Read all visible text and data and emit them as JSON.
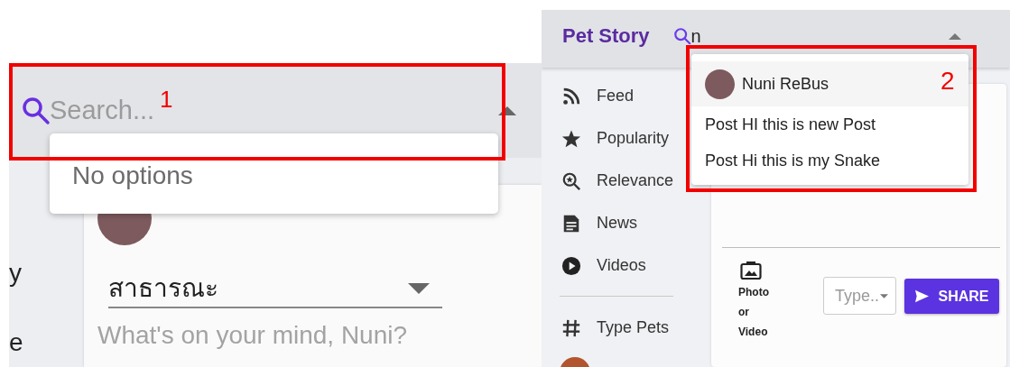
{
  "left_screenshot": {
    "search": {
      "placeholder": "Search..."
    },
    "search_dropdown": {
      "empty_text": "No options"
    },
    "annotation": {
      "label": "1"
    },
    "sidebar_partial": [
      "y",
      "e"
    ],
    "post_form": {
      "audience": "สาธารณะ",
      "placeholder": "What's on your mind, Nuni?"
    }
  },
  "right_screenshot": {
    "app_title": "Pet Story",
    "search": {
      "value": "n"
    },
    "annotation": {
      "label": "2"
    },
    "search_dropdown": {
      "options": [
        {
          "kind": "user",
          "label": "Nuni ReBus",
          "selected": true
        },
        {
          "kind": "post",
          "label": "Post HI this is new Post",
          "selected": false
        },
        {
          "kind": "post",
          "label": "Post Hi this is my Snake",
          "selected": false
        }
      ]
    },
    "sidebar": {
      "items": [
        "Feed",
        "Popularity",
        "Relevance",
        "News",
        "Videos"
      ],
      "extra_items": [
        "Type Pets"
      ]
    },
    "post_form": {
      "attachment_label": "Photo or Video",
      "type_select": {
        "placeholder": "Type.."
      },
      "share_button": "SHARE"
    }
  }
}
